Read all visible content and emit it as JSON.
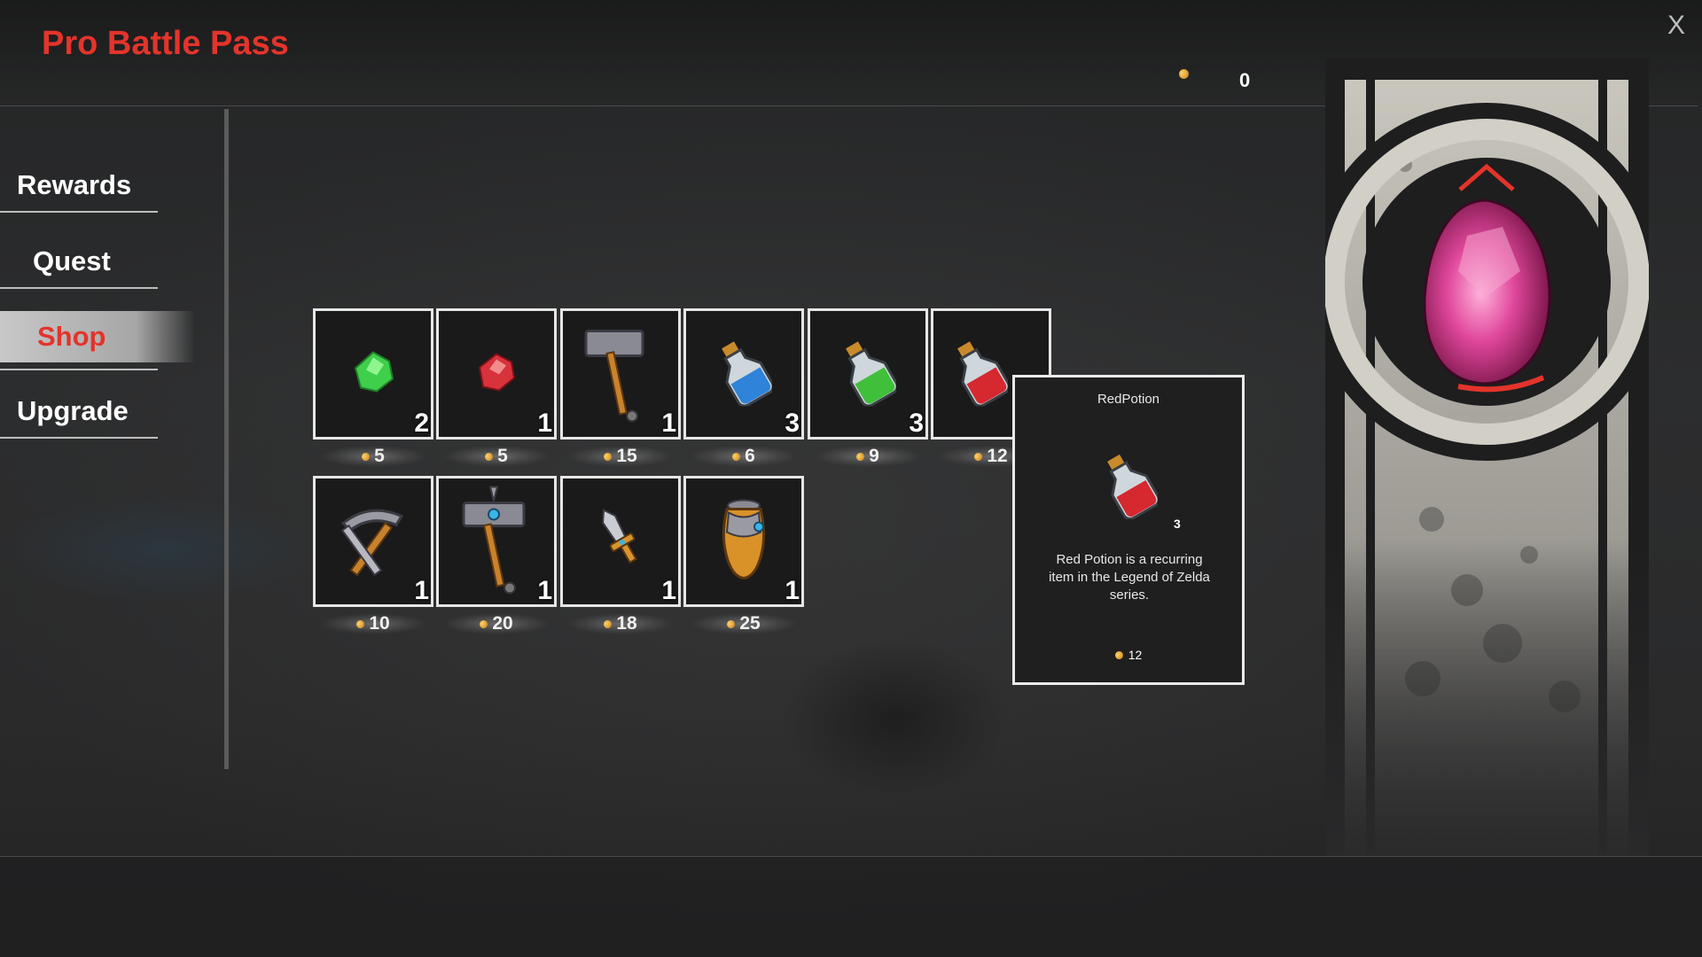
{
  "header": {
    "title": "Pro Battle Pass",
    "close_label": "X",
    "currency": {
      "icon": "coin-icon",
      "value": "0"
    }
  },
  "sidebar": {
    "items": [
      {
        "label": "Rewards",
        "active": false
      },
      {
        "label": "Quest",
        "active": false
      },
      {
        "label": "Shop",
        "active": true
      },
      {
        "label": "Upgrade",
        "active": false
      }
    ]
  },
  "shop": {
    "items": [
      {
        "name": "green-gem",
        "icon": "green-gem-icon",
        "qty": "2",
        "price": "5"
      },
      {
        "name": "red-gem",
        "icon": "red-gem-icon",
        "qty": "1",
        "price": "5"
      },
      {
        "name": "war-hammer",
        "icon": "hammer-icon",
        "qty": "1",
        "price": "15"
      },
      {
        "name": "blue-potion",
        "icon": "blue-potion-icon",
        "qty": "3",
        "price": "6"
      },
      {
        "name": "green-potion",
        "icon": "green-potion-icon",
        "qty": "3",
        "price": "9"
      },
      {
        "name": "red-potion",
        "icon": "red-potion-icon",
        "qty": "",
        "price": "12"
      },
      {
        "name": "pickaxe",
        "icon": "pickaxe-icon",
        "qty": "1",
        "price": "10"
      },
      {
        "name": "gem-hammer",
        "icon": "gem-hammer-icon",
        "qty": "1",
        "price": "20"
      },
      {
        "name": "dagger",
        "icon": "dagger-icon",
        "qty": "1",
        "price": "18"
      },
      {
        "name": "armor",
        "icon": "armor-icon",
        "qty": "1",
        "price": "25"
      }
    ]
  },
  "tooltip": {
    "name": "RedPotion",
    "qty": "3",
    "description": "Red Potion is a recurring item in the Legend of Zelda series.",
    "price": "12"
  },
  "colors": {
    "accent": "#e3342b",
    "border": "#e6e6e6",
    "coin": "#d08a1c"
  }
}
